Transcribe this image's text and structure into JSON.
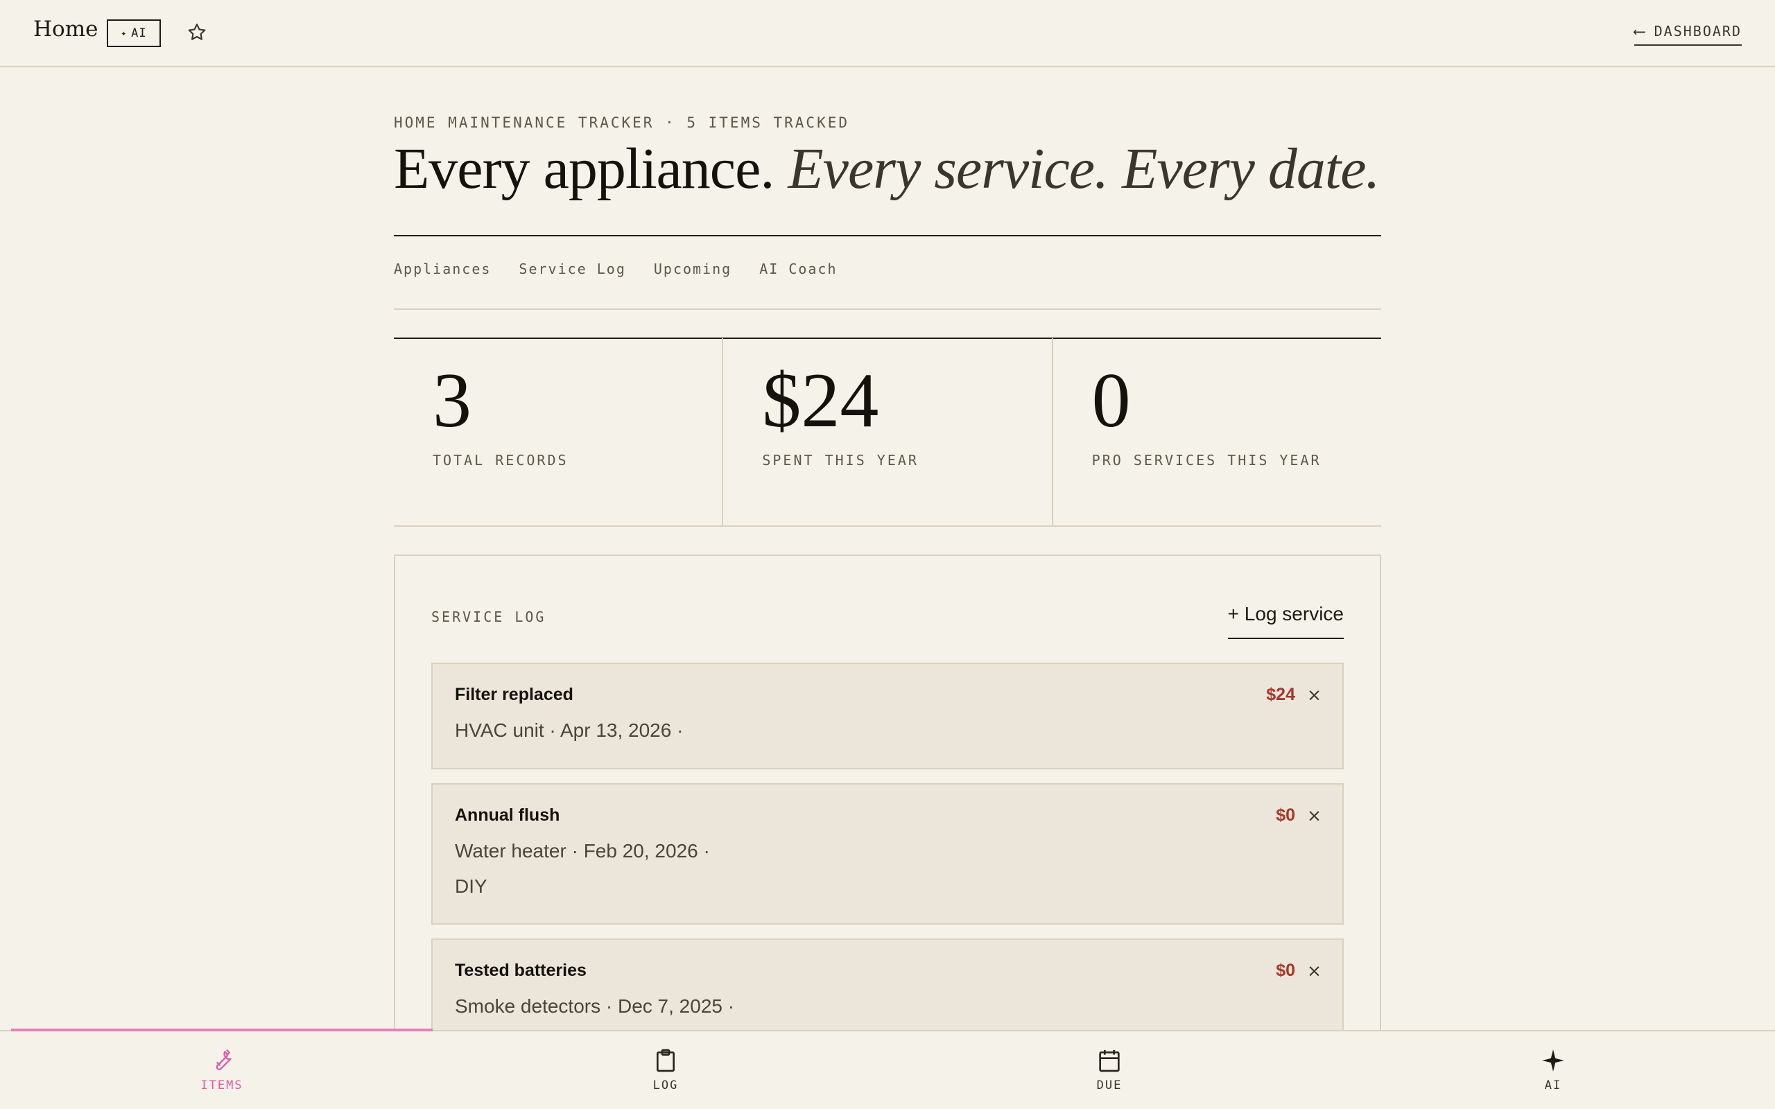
{
  "topbar": {
    "title": "Home",
    "ai_badge_icon": "sparkle-icon",
    "ai_badge_label": "AI",
    "favorite_icon": "star-icon",
    "dashboard_link": "DASHBOARD",
    "back_icon": "arrow-left-icon"
  },
  "header": {
    "eyebrow": "HOME MAINTENANCE TRACKER · 5 ITEMS TRACKED",
    "headline_main": "Every appliance.",
    "headline_accent": "Every service. Every date."
  },
  "tabs": [
    {
      "label": "Appliances"
    },
    {
      "label": "Service Log"
    },
    {
      "label": "Upcoming"
    },
    {
      "label": "AI Coach"
    }
  ],
  "stats": [
    {
      "value": "3",
      "label": "TOTAL RECORDS"
    },
    {
      "value": "$24",
      "label": "SPENT THIS YEAR"
    },
    {
      "value": "0",
      "label": "PRO SERVICES THIS YEAR"
    }
  ],
  "service_log": {
    "title": "SERVICE LOG",
    "add_label": "+ Log service",
    "records": [
      {
        "title": "Filter replaced",
        "meta": "HVAC unit · Apr 13, 2026 ·",
        "type": "",
        "cost": "$24",
        "delete": "×"
      },
      {
        "title": "Annual flush",
        "meta": "Water heater · Feb 20, 2026 ·",
        "type": "DIY",
        "cost": "$0",
        "delete": "×"
      },
      {
        "title": "Tested batteries",
        "meta": "Smoke detectors · Dec 7, 2025 ·",
        "type": "",
        "cost": "$0",
        "delete": "×"
      }
    ]
  },
  "bottom_nav": {
    "active_color": "#e05aa6",
    "items": [
      {
        "label": "ITEMS",
        "icon": "wrench-icon"
      },
      {
        "label": "LOG",
        "icon": "clipboard-icon"
      },
      {
        "label": "DUE",
        "icon": "calendar-icon"
      },
      {
        "label": "AI",
        "icon": "sparkle-icon"
      }
    ]
  },
  "colors": {
    "background": "#f5f2e9",
    "card": "#ebe6d9",
    "cost": "#a8362a",
    "accent": "#e87dbb"
  }
}
